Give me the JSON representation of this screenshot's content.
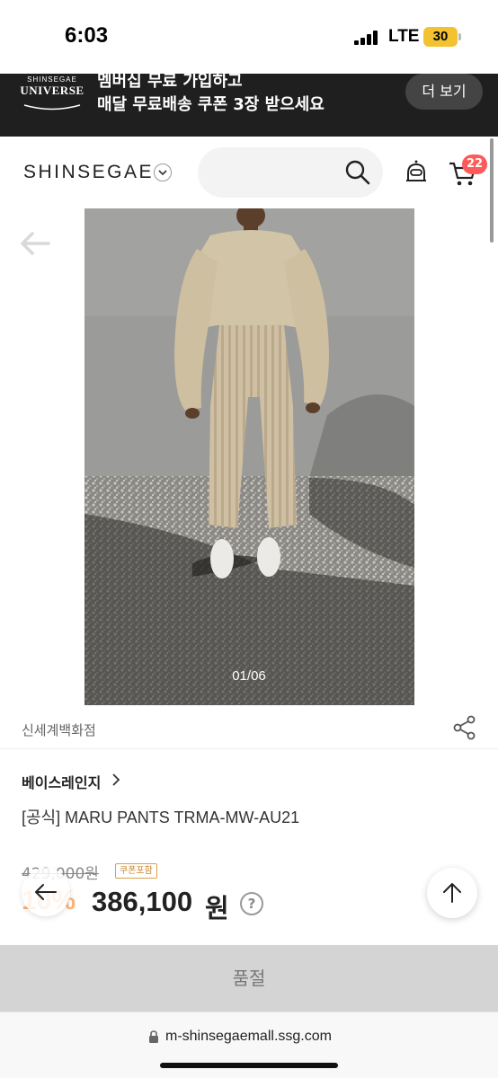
{
  "status_bar": {
    "time": "6:03",
    "network": "LTE",
    "battery": "30"
  },
  "promo_banner": {
    "logo_small": "SHINSEGAE",
    "logo_big": "UNIVERSE",
    "line1": "멤버십 무료 가입하고",
    "line2": "매달 무료배송 쿠폰 3장 받으세요",
    "more_button": "더 보기"
  },
  "header": {
    "brand": "SHINSEGAE",
    "cart_count": "22"
  },
  "product": {
    "photo_counter": "01/06",
    "store": "신세계백화점",
    "brand": "베이스레인지",
    "title": "[공식] MARU PANTS TRMA-MW-AU21",
    "original_price": "429,000원",
    "coupon_label": "쿠폰포함",
    "discount": "10%",
    "sale_price": "386,100",
    "currency": "원",
    "help": "?"
  },
  "soldout_label": "품절",
  "url_bar": {
    "url": "m-shinsegaemall.ssg.com"
  },
  "colors": {
    "cart_badge": "#ff5a5a",
    "discount": "#ffb07a",
    "banner_bg": "#1f1f1f"
  }
}
